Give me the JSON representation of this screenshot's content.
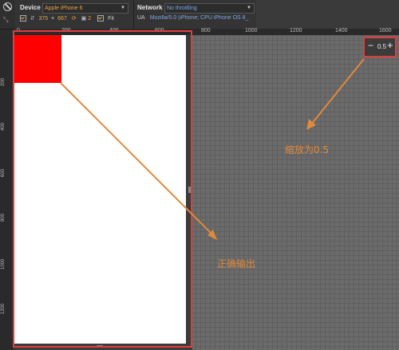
{
  "toolbar": {
    "device_label": "Device",
    "device_value": "Apple iPhone 6",
    "width": "375",
    "times": "×",
    "height": "667",
    "dpr": "2",
    "fit_label": "Fit",
    "network_label": "Network",
    "network_value": "No throttling",
    "ua_label": "UA",
    "ua_value": "Mozilla/5.0 (iPhone; CPU iPhone OS 8_"
  },
  "ruler": {
    "top": [
      "0",
      "200",
      "400",
      "600",
      "800",
      "1000",
      "1200",
      "1400",
      "1600"
    ],
    "left": [
      "200",
      "400",
      "600",
      "800",
      "1000",
      "1200"
    ]
  },
  "zoom": {
    "minus": "−",
    "value": "0.5",
    "plus": "+"
  },
  "annotations": {
    "zoom_note": "缩放为0.5",
    "output_note": "正确输出"
  },
  "colors": {
    "accent": "#e08a3a",
    "highlight": "#e23d3d",
    "square": "#ff0000"
  }
}
